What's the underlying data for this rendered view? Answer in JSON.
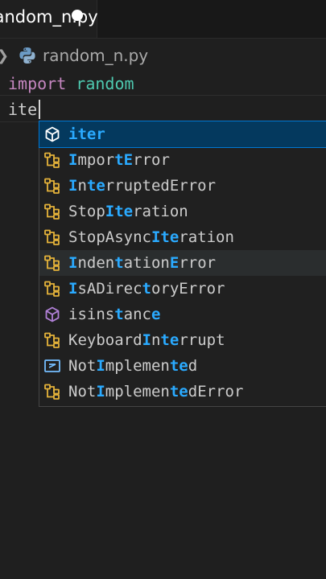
{
  "tab": {
    "filename": "random_n.py"
  },
  "breadcrumb": {
    "file": "random_n.py"
  },
  "editor": {
    "line1": {
      "keyword": "import",
      "module": "random"
    },
    "line2": {
      "typed": "ite"
    }
  },
  "suggestions": [
    {
      "icon": "function-icon",
      "parts": [
        [
          "iter",
          true
        ]
      ]
    },
    {
      "icon": "class-icon",
      "parts": [
        [
          "I",
          true
        ],
        [
          "mpor",
          false
        ],
        [
          "t",
          true
        ],
        [
          "E",
          true
        ],
        [
          "rror",
          false
        ]
      ]
    },
    {
      "icon": "class-icon",
      "parts": [
        [
          "I",
          true
        ],
        [
          "n",
          false
        ],
        [
          "te",
          true
        ],
        [
          "rruptedError",
          false
        ]
      ]
    },
    {
      "icon": "class-icon",
      "parts": [
        [
          "Stop",
          false
        ],
        [
          "Ite",
          true
        ],
        [
          "ration",
          false
        ]
      ]
    },
    {
      "icon": "class-icon",
      "parts": [
        [
          "StopAsync",
          false
        ],
        [
          "Ite",
          true
        ],
        [
          "ration",
          false
        ]
      ]
    },
    {
      "icon": "class-icon",
      "parts": [
        [
          "I",
          true
        ],
        [
          "nden",
          false
        ],
        [
          "t",
          true
        ],
        [
          "ation",
          false
        ],
        [
          "E",
          true
        ],
        [
          "rror",
          false
        ]
      ]
    },
    {
      "icon": "class-icon",
      "parts": [
        [
          "I",
          true
        ],
        [
          "sADirec",
          false
        ],
        [
          "t",
          true
        ],
        [
          "oryError",
          false
        ]
      ]
    },
    {
      "icon": "function-icon",
      "parts": [
        [
          "isins",
          false
        ],
        [
          "t",
          true
        ],
        [
          "anc",
          false
        ],
        [
          "e",
          true
        ]
      ]
    },
    {
      "icon": "class-icon",
      "parts": [
        [
          "Keyboard",
          false
        ],
        [
          "I",
          true
        ],
        [
          "n",
          false
        ],
        [
          "te",
          true
        ],
        [
          "rrupt",
          false
        ]
      ]
    },
    {
      "icon": "constant-icon",
      "parts": [
        [
          "Not",
          false
        ],
        [
          "I",
          true
        ],
        [
          "mplemen",
          false
        ],
        [
          "te",
          true
        ],
        [
          "d",
          false
        ]
      ]
    },
    {
      "icon": "class-icon",
      "parts": [
        [
          "Not",
          false
        ],
        [
          "I",
          true
        ],
        [
          "mplemen",
          false
        ],
        [
          "te",
          true
        ],
        [
          "dError",
          false
        ]
      ]
    }
  ],
  "colors": {
    "background": "#1f1f1f",
    "selected_background": "#04395e",
    "match_highlight": "#2aaaff",
    "class_icon": "#e5b33a",
    "function_icon": "#b180d7",
    "keyword": "#c586c0",
    "module": "#4ec9b0"
  }
}
